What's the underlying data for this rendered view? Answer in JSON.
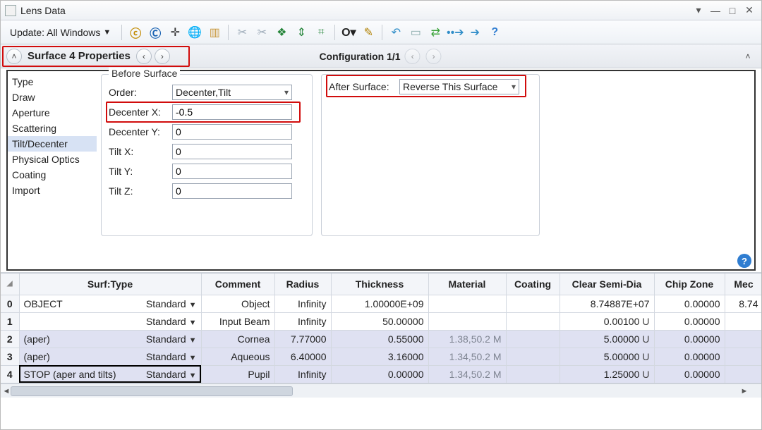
{
  "window": {
    "title": "Lens Data"
  },
  "toolbar": {
    "update_label": "Update: All Windows"
  },
  "prop_header": {
    "title": "Surface  4 Properties",
    "config_label": "Configuration 1/1"
  },
  "tabs": [
    "Type",
    "Draw",
    "Aperture",
    "Scattering",
    "Tilt/Decenter",
    "Physical Optics",
    "Coating",
    "Import"
  ],
  "selected_tab": "Tilt/Decenter",
  "before_surface": {
    "legend": "Before Surface",
    "order_label": "Order:",
    "order_value": "Decenter,Tilt",
    "dx_label": "Decenter X:",
    "dx_value": "-0.5",
    "dy_label": "Decenter Y:",
    "dy_value": "0",
    "tx_label": "Tilt X:",
    "tx_value": "0",
    "ty_label": "Tilt Y:",
    "ty_value": "0",
    "tz_label": "Tilt Z:",
    "tz_value": "0"
  },
  "after_surface": {
    "label": "After Surface:",
    "value": "Reverse This Surface"
  },
  "grid": {
    "headers": [
      "",
      "Surf:Type",
      "Comment",
      "Radius",
      "Thickness",
      "Material",
      "Coating",
      "Clear Semi-Dia",
      "Chip Zone",
      "Mec"
    ],
    "rows": [
      {
        "num": "0",
        "surf": "OBJECT",
        "type": "Standard",
        "comment": "Object",
        "radius": "Infinity",
        "thickness": "1.00000E+09",
        "material": "",
        "coating": "",
        "csd": "8.74887E+07",
        "csd_suffix": "",
        "chip": "0.00000",
        "mec": "8.74",
        "shade": false
      },
      {
        "num": "1",
        "surf": "",
        "type": "Standard",
        "comment": "Input Beam",
        "radius": "Infinity",
        "thickness": "50.00000",
        "material": "",
        "coating": "",
        "csd": "0.00100",
        "csd_suffix": "U",
        "chip": "0.00000",
        "mec": "",
        "shade": false
      },
      {
        "num": "2",
        "surf": "(aper)",
        "type": "Standard",
        "comment": "Cornea",
        "radius": "7.77000",
        "thickness": "0.55000",
        "material": "1.38,50.2 M",
        "coating": "",
        "csd": "5.00000",
        "csd_suffix": "U",
        "chip": "0.00000",
        "mec": "",
        "shade": true
      },
      {
        "num": "3",
        "surf": "(aper)",
        "type": "Standard",
        "comment": "Aqueous",
        "radius": "6.40000",
        "thickness": "3.16000",
        "material": "1.34,50.2 M",
        "coating": "",
        "csd": "5.00000",
        "csd_suffix": "U",
        "chip": "0.00000",
        "mec": "",
        "shade": true
      },
      {
        "num": "4",
        "surf": "STOP (aper and tilts)",
        "type": "Standard",
        "comment": "Pupil",
        "radius": "Infinity",
        "thickness": "0.00000",
        "material": "1.34,50.2 M",
        "coating": "",
        "csd": "1.25000",
        "csd_suffix": "U",
        "chip": "0.00000",
        "mec": "",
        "shade": true
      }
    ]
  }
}
